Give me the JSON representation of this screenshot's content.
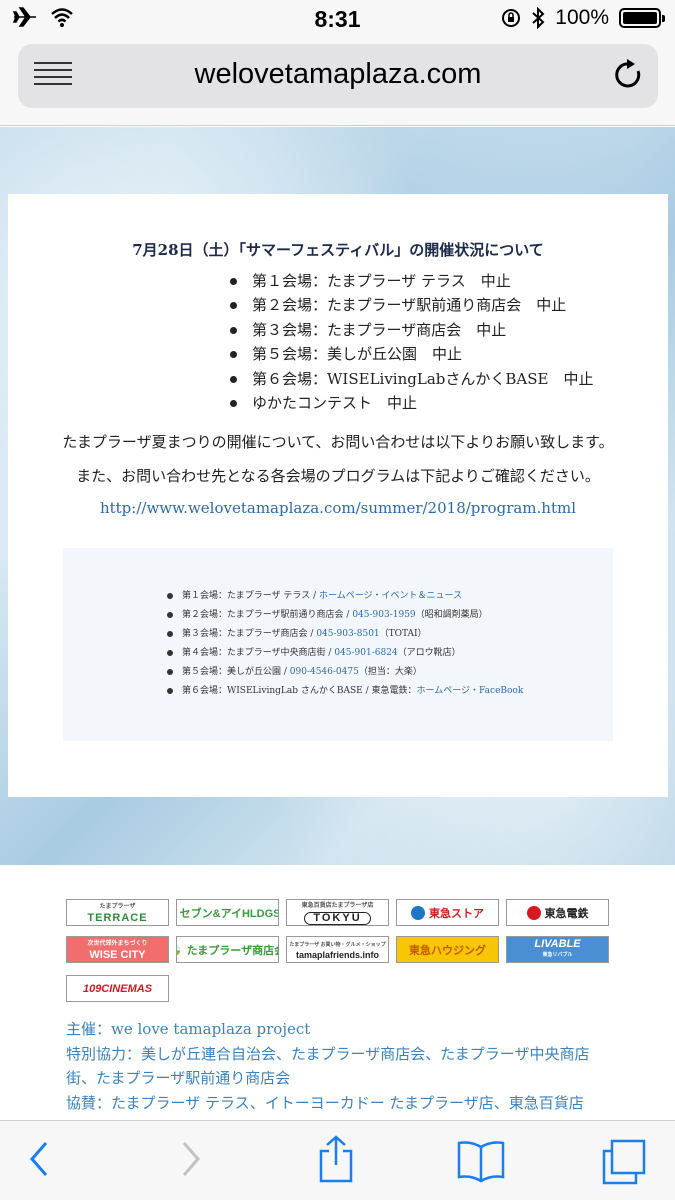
{
  "status": {
    "time": "8:31",
    "battery": "100%",
    "battery_level": 1.0
  },
  "browser": {
    "url": "welovetamaplaza.com"
  },
  "notice": {
    "title": "7月28日（土）「サマーフェスティバル」の開催状況について",
    "venues": [
      "第１会場：たまプラーザ テラス　中止",
      "第２会場：たまプラーザ駅前通り商店会　中止",
      "第３会場：たまプラーザ商店会　中止",
      "第５会場：美しが丘公園　中止",
      "第６会場：WISELivingLabさんかくBASE　中止",
      "ゆかたコンテスト　中止"
    ],
    "message1": "たまプラーザ夏まつりの開催について、お問い合わせは以下よりお願い致します。",
    "message2": "また、お問い合わせ先となる各会場のプログラムは下記よりご確認ください。",
    "link": "http://www.welovetamaplaza.com/summer/2018/program.html"
  },
  "contacts": [
    {
      "label": "第１会場：たまプラーザ テラス / ",
      "link": "ホームページ・イベント＆ニュース",
      "note": ""
    },
    {
      "label": "第２会場：たまプラーザ駅前通り商店会 / ",
      "link": "045-903-1959",
      "note": "（昭和調剤薬局）"
    },
    {
      "label": "第３会場：たまプラーザ商店会 / ",
      "link": "045-903-8501",
      "note": "（TOTAI）"
    },
    {
      "label": "第４会場：たまプラーザ中央商店街 / ",
      "link": "045-901-6824",
      "note": "（アロウ靴店）"
    },
    {
      "label": "第５会場：美しが丘公園 / ",
      "link": "090-4546-0475",
      "note": "（担当：大楽）"
    },
    {
      "label": "第６会場：WISELivingLab さんかくBASE / 東急電鉄：",
      "link": "ホームページ・FaceBook",
      "note": ""
    }
  ],
  "sponsors": [
    {
      "name": "TERRACE",
      "sub": "たまプラーザ",
      "color": "#2e8b3c"
    },
    {
      "name": "セブン&アイHLDGS.",
      "sub": "",
      "color": "#e0322d"
    },
    {
      "name": "TOKYU",
      "sub": "東急百貨店たまプラーザ店",
      "color": "#222222"
    },
    {
      "name": "東急ストア",
      "sub": "",
      "color": "#d7191f"
    },
    {
      "name": "東急電鉄",
      "sub": "",
      "color": "#d7191f"
    },
    {
      "name": "WISE CITY",
      "sub": "次世代郊外まちづくり",
      "color": "#e0322d"
    },
    {
      "name": "たまプラーザ商店会",
      "sub": "",
      "color": "#3c9a3c"
    },
    {
      "name": "tamaplafriends.info",
      "sub": "たまプラーザ お買い物・グルメ・ショップ",
      "color": "#333333"
    },
    {
      "name": "東急ハウジング",
      "sub": "",
      "color": "#d99a00"
    },
    {
      "name": "LIVABLE",
      "sub": "東急リバブル",
      "color": "#ffffff"
    },
    {
      "name": "109CINEMAS",
      "sub": "",
      "color": "#d7191f"
    }
  ],
  "credits": [
    "主催：we love tamaplaza project",
    "特別協力：美しが丘連合自治会、たまプラーザ商店会、たまプラーザ中央商店",
    "街、たまプラーザ駅前通り商店会",
    "協賛：たまプラーザ テラス、イトーヨーカドー たまプラーザ店、東急百貨店"
  ],
  "colors": {
    "link": "#2b6aa8",
    "credits": "#3a82bd",
    "title": "#1b2a4a",
    "ios_blue": "#1a7ef0"
  }
}
